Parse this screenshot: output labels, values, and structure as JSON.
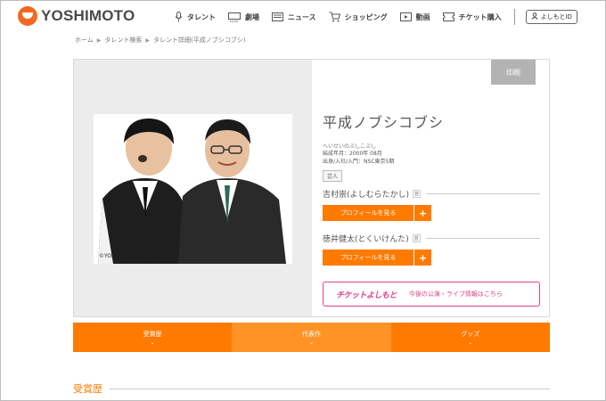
{
  "header": {
    "brand": "YOSHIMOTO",
    "nav": [
      {
        "label": "タレント",
        "icon": "microphone-icon"
      },
      {
        "label": "劇場",
        "icon": "theater-icon"
      },
      {
        "label": "ニュース",
        "icon": "news-icon"
      },
      {
        "label": "ショッピング",
        "icon": "cart-icon"
      },
      {
        "label": "動画",
        "icon": "video-icon"
      },
      {
        "label": "チケット購入",
        "icon": "ticket-icon"
      }
    ],
    "login_label": "よしもとID"
  },
  "breadcrumb": [
    "ホーム",
    "タレント検索",
    "タレント詳細(平成ノブシコブシ)"
  ],
  "profile": {
    "print_label": "印刷",
    "name": "平成ノブシコブシ",
    "kana": "へいせいのぶしこぶし",
    "formed": "結成年月：2000年 08月",
    "origin": "出身/入社/入門：NSC東京5期",
    "tag": "芸人",
    "copyright": "©YOSHIMOTO KOGYO CO.,LTD.",
    "members": [
      {
        "name": "吉村崇(よしむらたかし)",
        "badge": "芸",
        "button": "プロフィールを見る",
        "plus": "+"
      },
      {
        "name": "徳井健太(とくいけんた)",
        "badge": "芸",
        "button": "プロフィールを見る",
        "plus": "+"
      }
    ],
    "ticket_logo": "チケットよしもと",
    "ticket_text": "今後の公演・ライブ情報はこちら"
  },
  "tabs": [
    {
      "label": "受賞歴",
      "chevron": "⌄"
    },
    {
      "label": "代表作",
      "chevron": "⌄"
    },
    {
      "label": "グッズ",
      "chevron": "⌄"
    }
  ],
  "section": {
    "title": "受賞歴"
  },
  "colors": {
    "accent": "#ff7a00",
    "accent_light": "#ff9326",
    "ticket_pink": "#e0408a",
    "brand_red": "#f26a21"
  }
}
